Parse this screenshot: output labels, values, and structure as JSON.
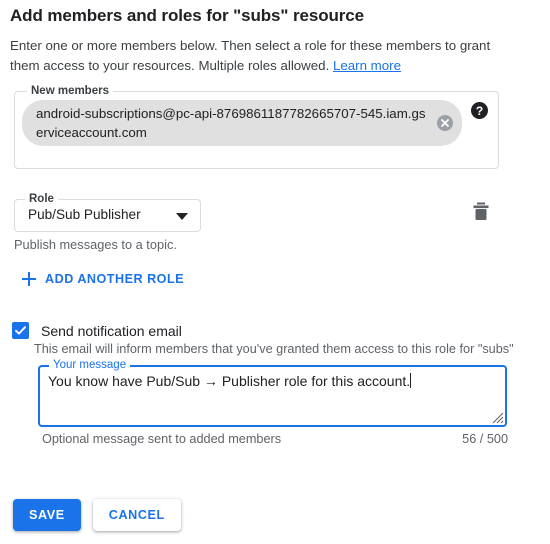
{
  "dialog": {
    "title": "Add members and roles for \"subs\" resource",
    "description_part1": "Enter one or more members below. Then select a role for these members to grant them access to your resources. Multiple roles allowed. ",
    "learn_more_label": "Learn more"
  },
  "members": {
    "legend": "New members",
    "chip_value": "android-subscriptions@pc-api-8769861187782665707-545.iam.gserviceaccount.com",
    "clear_icon": "close-circle-icon",
    "help_icon": "help-circle-icon"
  },
  "role": {
    "legend": "Role",
    "selected": "Pub/Sub Publisher",
    "dropdown_icon": "chevron-down-icon",
    "helper_text": "Publish messages to a topic.",
    "delete_icon": "trash-icon"
  },
  "add_role": {
    "label": "ADD ANOTHER ROLE",
    "icon": "plus-icon"
  },
  "notification": {
    "checkbox_label": "Send notification email",
    "checkbox_checked": true,
    "check_icon": "check-icon",
    "helper_text": "This email will inform members that you've granted them access to this role for \"subs\"",
    "message_legend": "Your message",
    "message_value": "You know have Pub/Sub → Publisher role for this account.",
    "message_hint": "Optional message sent to added members",
    "char_count": "56 / 500",
    "resize_icon": "resize-handle-icon"
  },
  "actions": {
    "save_label": "SAVE",
    "cancel_label": "CANCEL"
  },
  "colors": {
    "accent": "#1a73e8",
    "text": "#202124",
    "muted": "#5f6368",
    "border": "#dadce0",
    "chip_bg": "#e0e0e0"
  }
}
